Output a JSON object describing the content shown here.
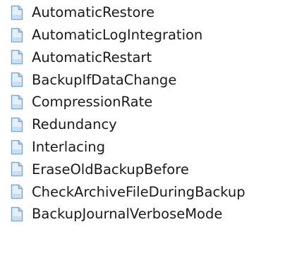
{
  "file_list": {
    "items": [
      {
        "name": "AutomaticRestore",
        "icon": "document-icon"
      },
      {
        "name": "AutomaticLogIntegration",
        "icon": "document-icon"
      },
      {
        "name": "AutomaticRestart",
        "icon": "document-icon"
      },
      {
        "name": "BackupIfDataChange",
        "icon": "document-icon"
      },
      {
        "name": "CompressionRate",
        "icon": "document-icon"
      },
      {
        "name": "Redundancy",
        "icon": "document-icon"
      },
      {
        "name": "Interlacing",
        "icon": "document-icon"
      },
      {
        "name": "EraseOldBackupBefore",
        "icon": "document-icon"
      },
      {
        "name": "CheckArchiveFileDuringBackup",
        "icon": "document-icon"
      },
      {
        "name": "BackupJournalVerboseMode",
        "icon": "document-icon"
      }
    ]
  },
  "colors": {
    "icon_page": "#e3f0fb",
    "icon_border": "#7ea7cf",
    "icon_fold": "#b7d3ee",
    "text": "#1a1a1a",
    "background": "#ffffff"
  }
}
